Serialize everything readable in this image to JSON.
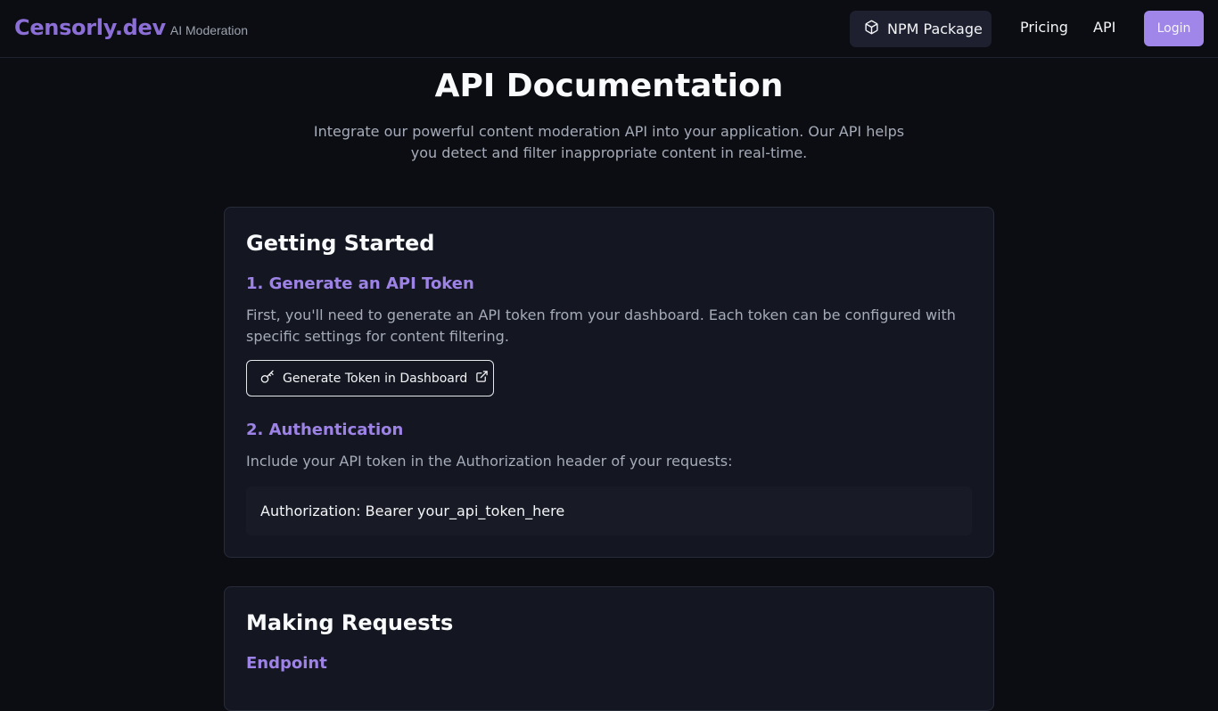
{
  "nav": {
    "brand": "Censorly.dev",
    "tagline": "AI Moderation",
    "npm_label": "NPM Package",
    "pricing_label": "Pricing",
    "api_label": "API",
    "login_label": "Login"
  },
  "hero": {
    "title": "API Documentation",
    "subtitle": "Integrate our powerful content moderation API into your application. Our API helps you detect and filter inappropriate content in real-time."
  },
  "getting_started": {
    "title": "Getting Started",
    "step1_title": "1. Generate an API Token",
    "step1_text": "First, you'll need to generate an API token from your dashboard. Each token can be configured with specific settings for content filtering.",
    "step1_button": "Generate Token in Dashboard",
    "step2_title": "2. Authentication",
    "step2_text": "Include your API token in the Authorization header of your requests:",
    "code": "Authorization: Bearer your_api_token_here"
  },
  "making_requests": {
    "title": "Making Requests",
    "endpoint_title": "Endpoint"
  },
  "colors": {
    "accent": "#9d83e6",
    "brand": "#8b6fd6",
    "login_bg": "#9f86e8",
    "background": "#0c0d12",
    "card_bg": "#141722"
  },
  "icons": {
    "npm": "package-icon",
    "key": "key-icon",
    "external": "external-link-icon"
  }
}
